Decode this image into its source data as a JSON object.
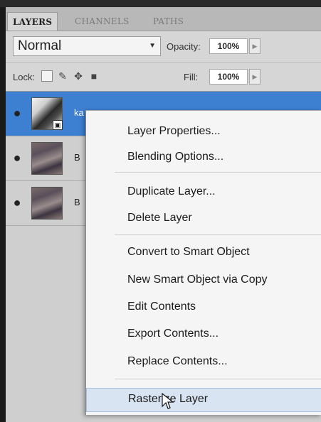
{
  "tabs": [
    "LAYERS",
    "CHANNELS",
    "PATHS"
  ],
  "blend_mode": "Normal",
  "opacity": {
    "label": "Opacity:",
    "value": "100%"
  },
  "lock": {
    "label": "Lock:"
  },
  "fill": {
    "label": "Fill:",
    "value": "100%"
  },
  "layers": [
    {
      "name": "ka",
      "selected": true,
      "smart_object": true
    },
    {
      "name": "B",
      "selected": false
    },
    {
      "name": "B",
      "selected": false
    }
  ],
  "context_menu": {
    "items": [
      "Layer Properties...",
      "Blending Options...",
      "Duplicate Layer...",
      "Delete Layer",
      "Convert to Smart Object",
      "New Smart Object via Copy",
      "Edit Contents",
      "Export Contents...",
      "Replace Contents...",
      "Rasterize Layer"
    ],
    "hovered_item": "Rasterize Layer"
  },
  "colors": {
    "selection": "#3d7fd1",
    "panel": "#d6d6d6",
    "menu": "#f5f5f5"
  }
}
